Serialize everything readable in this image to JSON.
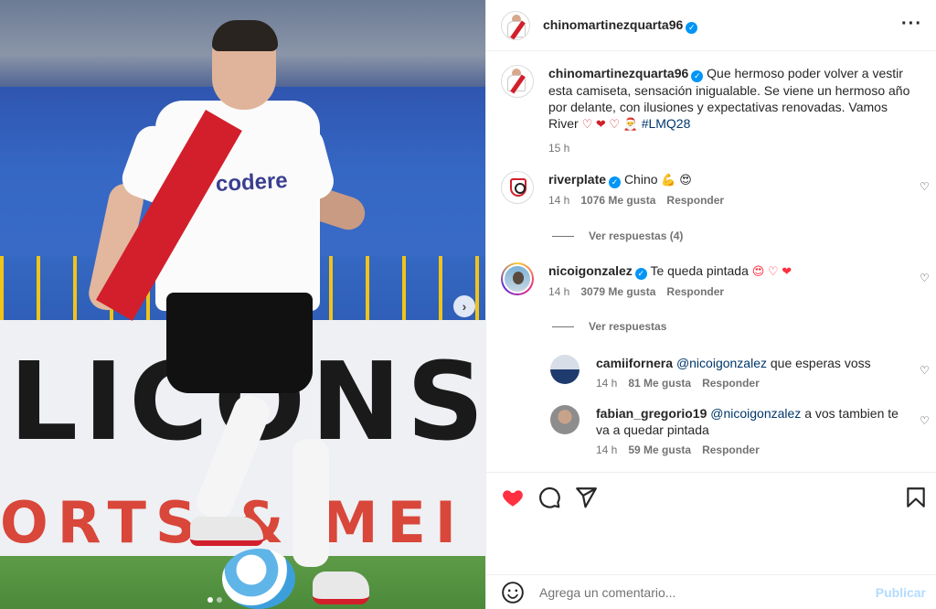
{
  "post": {
    "author": "chinomartinezquarta96",
    "caption_text": "Que hermoso poder volver a vestir esta camiseta, sensación inigualable. Se viene un hermoso año por delante, con ilusiones y expectativas renovadas. Vamos River",
    "caption_emojis": "♡ ❤ ♡ 🎅",
    "hashtag": "#LMQ28",
    "time": "15 h"
  },
  "photo": {
    "board_top": "LICONS",
    "board_bottom": "ORTS & MEI",
    "sponsor": "codere"
  },
  "comments": [
    {
      "user": "riverplate",
      "text": "Chino",
      "emojis": "💪 😍",
      "time": "14 h",
      "likes": "1076 Me gusta",
      "reply": "Responder",
      "view_replies": "Ver respuestas (4)"
    },
    {
      "user": "nicoigonzalez",
      "text": "Te queda pintada",
      "emojis": "😍 ♡ ❤",
      "time": "14 h",
      "likes": "3079 Me gusta",
      "reply": "Responder",
      "view_replies": "Ver respuestas"
    }
  ],
  "replies": [
    {
      "user": "camiifornera",
      "mention": "@nicoigonzalez",
      "text": "que esperas voss",
      "time": "14 h",
      "likes": "81 Me gusta",
      "reply": "Responder"
    },
    {
      "user": "fabian_gregorio19",
      "mention": "@nicoigonzalez",
      "text": "a vos tambien te va a quedar pintada",
      "time": "14 h",
      "likes": "59 Me gusta",
      "reply": "Responder"
    }
  ],
  "composer": {
    "placeholder": "Agrega un comentario...",
    "publish_label": "Publicar"
  },
  "colors": {
    "like_red": "#ff3040",
    "link_blue": "#00376b",
    "verified_blue": "#0095f6"
  }
}
